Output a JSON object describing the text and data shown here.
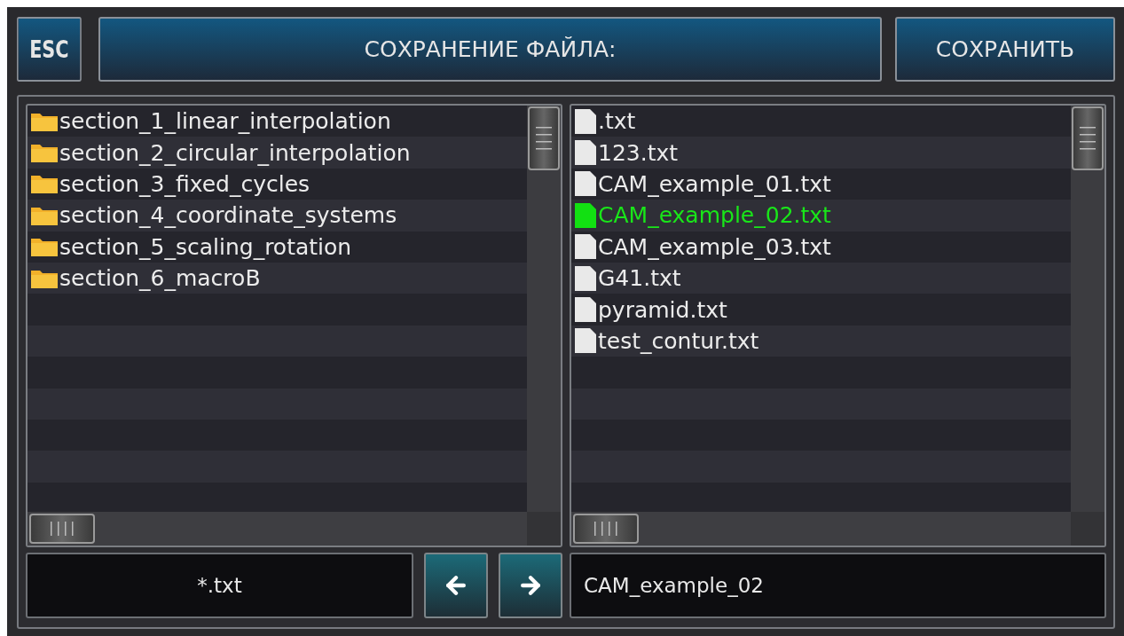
{
  "header": {
    "esc_button": "ESC",
    "title": "СОХРАНЕНИЕ ФАЙЛА:",
    "save_button": "СОХРАНИТЬ"
  },
  "folders": [
    {
      "name": "section_1_linear_interpolation"
    },
    {
      "name": "section_2_circular_interpolation"
    },
    {
      "name": "section_3_fixed_cycles"
    },
    {
      "name": "section_4_coordinate_systems"
    },
    {
      "name": "section_5_scaling_rotation"
    },
    {
      "name": "section_6_macroB"
    }
  ],
  "files": [
    {
      "name": ".txt",
      "selected": false
    },
    {
      "name": "123.txt",
      "selected": false
    },
    {
      "name": "CAM_example_01.txt",
      "selected": false
    },
    {
      "name": "CAM_example_02.txt",
      "selected": true
    },
    {
      "name": "CAM_example_03.txt",
      "selected": false
    },
    {
      "name": "G41.txt",
      "selected": false
    },
    {
      "name": "pyramid.txt",
      "selected": false
    },
    {
      "name": "test_contur.txt",
      "selected": false
    }
  ],
  "filter": {
    "value": "*.txt"
  },
  "filename": {
    "value": "CAM_example_02"
  }
}
